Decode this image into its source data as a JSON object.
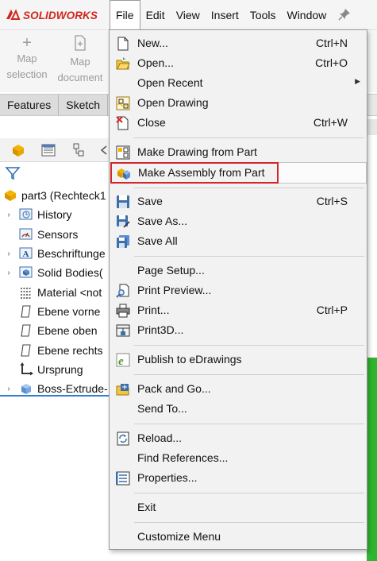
{
  "app": {
    "logo_text": "SOLIDWORKS",
    "brand_color": "#d0271d"
  },
  "menubar": {
    "items": [
      "File",
      "Edit",
      "View",
      "Insert",
      "Tools",
      "Window"
    ],
    "active": "File"
  },
  "command_manager": {
    "buttons": [
      {
        "label_line1": "Map",
        "label_line2": "selection",
        "icon": "plus-icon"
      },
      {
        "label_line1": "Map",
        "label_line2": "document",
        "icon": "add-document-icon"
      }
    ]
  },
  "tabs": [
    "Features",
    "Sketch"
  ],
  "tree": {
    "items": [
      {
        "label": "part3  (Rechteck1",
        "icon": "part-icon",
        "expander": ""
      },
      {
        "label": "History",
        "icon": "history-icon",
        "expander": "›"
      },
      {
        "label": "Sensors",
        "icon": "sensors-icon",
        "expander": ""
      },
      {
        "label": "Beschriftunge",
        "icon": "annotations-icon",
        "expander": "›"
      },
      {
        "label": "Solid Bodies(",
        "icon": "solid-bodies-icon",
        "expander": "›"
      },
      {
        "label": "Material <not",
        "icon": "material-icon",
        "expander": ""
      },
      {
        "label": "Ebene vorne",
        "icon": "plane-icon",
        "expander": ""
      },
      {
        "label": "Ebene oben",
        "icon": "plane-icon",
        "expander": ""
      },
      {
        "label": "Ebene rechts",
        "icon": "plane-icon",
        "expander": ""
      },
      {
        "label": "Ursprung",
        "icon": "origin-icon",
        "expander": ""
      },
      {
        "label": "Boss-Extrude-",
        "icon": "extrude-icon",
        "expander": "›"
      }
    ]
  },
  "file_menu": {
    "items": [
      {
        "label": "New...",
        "shortcut": "Ctrl+N",
        "icon": "new-document-icon"
      },
      {
        "label": "Open...",
        "shortcut": "Ctrl+O",
        "icon": "open-folder-icon"
      },
      {
        "label": "Open Recent",
        "shortcut": "",
        "icon": "",
        "submenu": true
      },
      {
        "label": "Open Drawing",
        "shortcut": "",
        "icon": "open-drawing-icon"
      },
      {
        "label": "Close",
        "shortcut": "Ctrl+W",
        "icon": "close-document-icon"
      },
      {
        "label": "Make Drawing from Part",
        "shortcut": "",
        "icon": "make-drawing-icon"
      },
      {
        "label": "Make Assembly from Part",
        "shortcut": "",
        "icon": "make-assembly-icon",
        "highlighted": true
      },
      {
        "label": "Save",
        "shortcut": "Ctrl+S",
        "icon": "save-icon"
      },
      {
        "label": "Save As...",
        "shortcut": "",
        "icon": "save-as-icon"
      },
      {
        "label": "Save All",
        "shortcut": "",
        "icon": "save-all-icon"
      },
      {
        "label": "Page Setup...",
        "shortcut": "",
        "icon": ""
      },
      {
        "label": "Print Preview...",
        "shortcut": "",
        "icon": "print-preview-icon"
      },
      {
        "label": "Print...",
        "shortcut": "Ctrl+P",
        "icon": "print-icon"
      },
      {
        "label": "Print3D...",
        "shortcut": "",
        "icon": "print3d-icon"
      },
      {
        "label": "Publish to eDrawings",
        "shortcut": "",
        "icon": "edrawings-icon"
      },
      {
        "label": "Pack and Go...",
        "shortcut": "",
        "icon": "pack-and-go-icon"
      },
      {
        "label": "Send To...",
        "shortcut": "",
        "icon": ""
      },
      {
        "label": "Reload...",
        "shortcut": "",
        "icon": "reload-icon"
      },
      {
        "label": "Find References...",
        "shortcut": "",
        "icon": ""
      },
      {
        "label": "Properties...",
        "shortcut": "",
        "icon": "properties-icon"
      },
      {
        "label": "Exit",
        "shortcut": "",
        "icon": ""
      },
      {
        "label": "Customize Menu",
        "shortcut": "",
        "icon": ""
      }
    ],
    "highlight_color": "#d3262a"
  }
}
